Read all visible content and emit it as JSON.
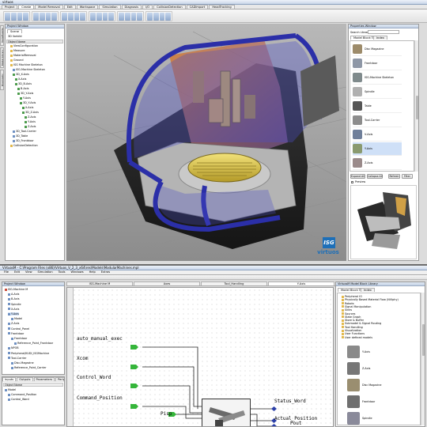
{
  "top": {
    "title": "virtuos",
    "menu": [
      "Project",
      "Create",
      "Model Removal",
      "Edit",
      "Workspace",
      "Simulation",
      "Diagnosis",
      "I/O",
      "CollisionDetection",
      "CADImport",
      "HeadTracking"
    ],
    "active_menu": "Create",
    "left_panel_title": "Project Window",
    "scene_tab": "Scene",
    "root_label": "3D Vorbild",
    "object_header": "Object Name",
    "tree": [
      {
        "label": "ViewConfiguration",
        "depth": 1
      },
      {
        "label": "Measure",
        "depth": 1
      },
      {
        "label": "MaterialRemoval",
        "depth": 1
      },
      {
        "label": "Ground",
        "depth": 1
      },
      {
        "label": "ISG Machine Skeleton",
        "depth": 1
      },
      {
        "label": "ISG-Machine Skeleton",
        "depth": 2
      },
      {
        "label": "3D_X-Axis",
        "depth": 2
      },
      {
        "label": "X-Axis",
        "depth": 3
      },
      {
        "label": "3D_B-Axis",
        "depth": 3
      },
      {
        "label": "B-Axis",
        "depth": 4
      },
      {
        "label": "3D_Y-Axis",
        "depth": 4
      },
      {
        "label": "Y-Axis",
        "depth": 5
      },
      {
        "label": "3D_Y-Axis",
        "depth": 5
      },
      {
        "label": "X-Axis",
        "depth": 6
      },
      {
        "label": "3D_Z-Axis",
        "depth": 6
      },
      {
        "label": "Z-Axis",
        "depth": 7
      },
      {
        "label": "Y-Axis",
        "depth": 7
      },
      {
        "label": "Z-Axis",
        "depth": 7
      },
      {
        "label": "3D_Tool-Carrier",
        "depth": 2
      },
      {
        "label": "3D_Table",
        "depth": 2
      },
      {
        "label": "3D_Frontdoor",
        "depth": 2
      },
      {
        "label": "CollisionDetection",
        "depth": 1
      }
    ],
    "side_tabs": [
      "Tools/Palette",
      "Model Library",
      "Diagnostic"
    ],
    "properties_title": "Properties Window",
    "search_label": "Search Library",
    "lib_tabs": [
      "Model Block Tree",
      "Index"
    ],
    "lib_items": [
      "Disc Magazine",
      "Frontdoor",
      "ISG-Machine Skeleton",
      "Spindle",
      "Table",
      "Tool-Carrier",
      "V-Axis",
      "Y-Axis",
      "Z-Axis"
    ],
    "lib_buttons": [
      "Expand All",
      "Collapse All",
      "Refresh",
      "Filter"
    ],
    "preview_label": "Preview",
    "logo_text": "virtuos",
    "logo_mark": "ISG"
  },
  "bottom": {
    "title": "VirtuosM - C:\\Program Files (x86)\\Virtuos_V_2_3_x64\\res\\Models\\ModularMachines.mpl",
    "menu": [
      "File",
      "Edit",
      "View",
      "Simulation",
      "Tools",
      "Windows",
      "Help",
      "Extras"
    ],
    "project_window": "Project Window",
    "doc_tabs": [
      "ISG-Machine M",
      "Axes",
      "Tool_Handling",
      "Y-Axis"
    ],
    "active_doc": "Y-Axis",
    "tree": [
      {
        "label": "ISG-Machine M",
        "depth": 0
      },
      {
        "label": "A-Axis",
        "depth": 1
      },
      {
        "label": "B-Axis",
        "depth": 1
      },
      {
        "label": "Spindle",
        "depth": 1
      },
      {
        "label": "X-Axis",
        "depth": 1
      },
      {
        "label": "Y-Axis",
        "depth": 1
      },
      {
        "label": "Model",
        "depth": 2
      },
      {
        "label": "Z-Axis",
        "depth": 1
      },
      {
        "label": "Control_Panel",
        "depth": 1
      },
      {
        "label": "Frontdoor",
        "depth": 1
      },
      {
        "label": "Frontdoor",
        "depth": 2
      },
      {
        "label": "Reference_Point_Frontdoor",
        "depth": 3
      },
      {
        "label": "NPOB",
        "depth": 1
      },
      {
        "label": "Peripheral/KUDI_ISGMachine",
        "depth": 1
      },
      {
        "label": "Tool-Carrier",
        "depth": 1
      },
      {
        "label": "Disc-Magazine",
        "depth": 2
      },
      {
        "label": "Reference_Point_Carrier",
        "depth": 2
      }
    ],
    "bottom_tabs": [
      "Inputs",
      "Outputs",
      "Parameters",
      "Peripheral IO"
    ],
    "bottom_header": "Object Name",
    "bottom_rows": [
      "Model",
      "Command_Position",
      "Control_Word"
    ],
    "canvas_labels": [
      "auto_manual_exec",
      "Xcom",
      "Control_Word",
      "Command_Position",
      "Pisp"
    ],
    "output_labels": [
      "Status_Word",
      "Actual_Position",
      "Pout"
    ],
    "library_title": "VirtuosM Model Block Library",
    "library_tabs": [
      "Model Block Tree",
      "Index"
    ],
    "library_tree": [
      "Peripheral IO",
      "Physically Based Material Flow (NVIphy)",
      "Robots",
      "Signal Manipulation",
      "Sinks",
      "Sources",
      "State Graph",
      "Store & Buffer",
      "Submodel & Signal Routing",
      "Tool Handling",
      "Visualization",
      "User Functions",
      "User defined models"
    ],
    "library_models": [
      "Y-Axis",
      "Z-Axis",
      "Disc Magazine",
      "Frontdoor",
      "Spindle"
    ]
  }
}
